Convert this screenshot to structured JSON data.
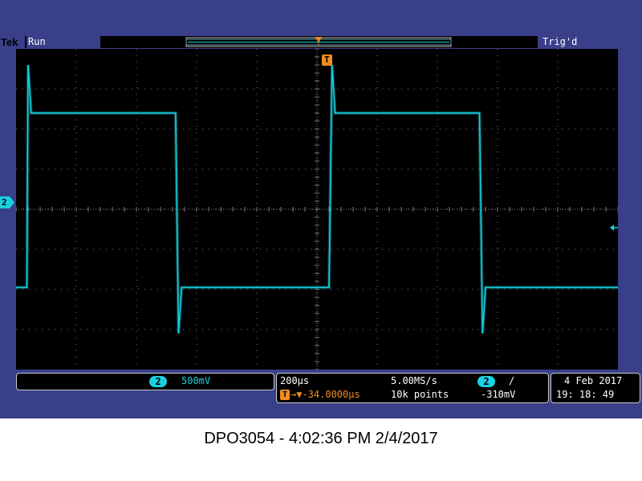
{
  "header": {
    "brand": "Tek",
    "acq_status": "Run",
    "trigger_status": "Trig'd"
  },
  "markers": {
    "channel_marker": "2",
    "trigger_marker": "T"
  },
  "vertical": {
    "channel": "2",
    "scale": "500mV"
  },
  "horizontal": {
    "time_per_div": "200µs",
    "sample_rate": "5.00MS/s",
    "delay_icon": "T",
    "delay": "→▼-34.0000µs",
    "record_length": "10k points"
  },
  "trigger": {
    "channel": "2",
    "slope_icon": "/",
    "level": "-310mV"
  },
  "datetime": {
    "date": "4 Feb   2017",
    "time": "19: 18: 49"
  },
  "footer": {
    "caption": "DPO3054 - 4:02:36 PM   2/4/2017"
  },
  "colors": {
    "waveform": "#19d1e0",
    "trigger_marker": "#f28c1e",
    "bezel": "#3a3f8a",
    "grid": "#7a7a7a"
  },
  "chart_data": {
    "type": "line",
    "title": "",
    "xlabel": "",
    "ylabel": "",
    "x_divisions": 10,
    "y_divisions": 8,
    "xlim_div": [
      0,
      10
    ],
    "ylim_div": [
      -4,
      4
    ],
    "series": [
      {
        "x_div": [
          0,
          0.18,
          0.2,
          0.25,
          2.6,
          2.65,
          2.7,
          2.75,
          5.15,
          5.2,
          5.25,
          5.3,
          7.65,
          7.7,
          7.75,
          7.8,
          10
        ],
        "y_div": [
          -1.95,
          -1.95,
          3.6,
          2.4,
          2.4,
          2.4,
          -3.1,
          -1.95,
          -1.95,
          -1.95,
          3.6,
          2.4,
          2.4,
          2.4,
          -3.1,
          -1.95,
          -1.95
        ]
      }
    ]
  }
}
